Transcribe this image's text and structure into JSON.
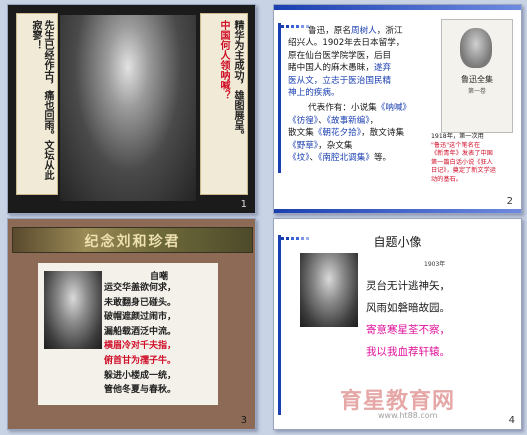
{
  "slides": [
    {
      "number": "1",
      "left_text": "先生已经作古，痛也回雨。文坛从此寂寥！",
      "right_text_a": "精华为主成功，雄图展呈。",
      "right_text_b": "中国何人领呐喊？"
    },
    {
      "number": "2",
      "line1_a": "鲁迅，原名",
      "line1_b": "周树人",
      "line1_c": "，浙江",
      "line2": "绍兴人。1902年去日本留学，",
      "line3": "原在仙台医学院学医，后目",
      "line4": "睹中国人的麻木愚昧，",
      "line4_b": "遂弃",
      "line5": "医从文，立志于医治国民精",
      "line6": "神上的疾病。",
      "works_label": "代表作有：小说集",
      "works_1": "《呐喊》",
      "works_2": "《彷徨》",
      "works_3": "《故事新编》",
      "works_prose": "散文集",
      "works_4": "《朝花夕拾》",
      "works_essay": "散文诗集",
      "works_5": "《野草》",
      "works_misc": "杂文集",
      "works_6": "《坟》",
      "works_7": "《南腔北调集》",
      "works_end": "等。",
      "book_title": "鲁迅全集",
      "book_sub": "第一卷",
      "caption1": "1918年，第一次用",
      "caption2": "\"鲁迅\"这个笔名在",
      "caption3": "《新青年》发表了中国",
      "caption4": "第一篇白话小说《狂人",
      "caption5": "日记》，奠定了新文学运",
      "caption6": "动的基石。"
    },
    {
      "number": "3",
      "banner": "纪念刘和珍君",
      "poem_title": "自嘲",
      "lines": [
        "运交华盖欲何求，",
        "未敢翻身已碰头。",
        "破帽遮颜过闹市，",
        "漏船载酒泛中流。",
        "横眉冷对千夫指，",
        "俯首甘为孺子牛。",
        "躲进小楼成一统，",
        "管他冬夏与春秋。"
      ]
    },
    {
      "number": "4",
      "title": "自题小像",
      "year": "1903年",
      "lines": [
        "灵台无计逃神矢，",
        "风雨如磐暗故园。",
        "寄意寒星荃不察，",
        "我以我血荐轩辕。"
      ],
      "watermark": "育星教育网",
      "watermark_url": "www.ht88.com"
    }
  ],
  "colors": {
    "bg": "#c9d3e6",
    "red": "#d0102a",
    "blue": "#1a3fb0",
    "slide3_bg": "#8c6a55"
  }
}
